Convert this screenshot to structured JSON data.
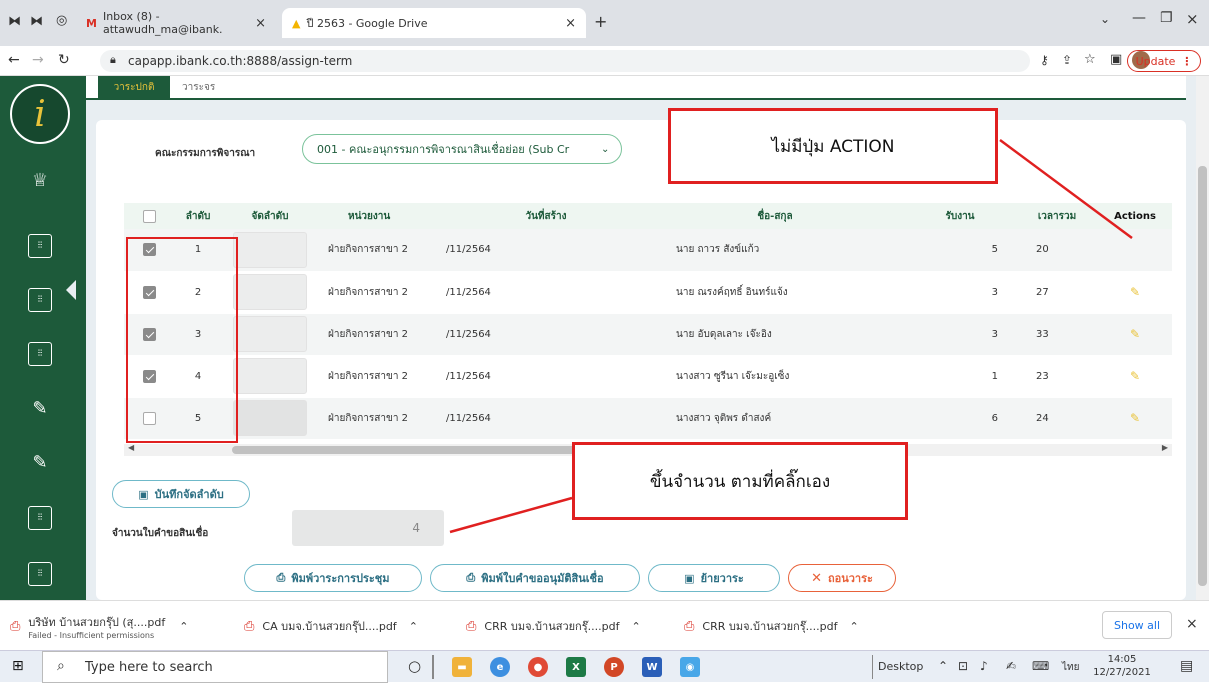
{
  "browser": {
    "tabs": [
      {
        "label": "Inbox (8) - attawudh_ma@ibank."
      },
      {
        "label": "ปี 2563 - Google Drive"
      }
    ],
    "new_tab": "+",
    "url": "capapp.ibank.co.th:8888/assign-term",
    "update_label": "Update"
  },
  "page": {
    "top_tabs": [
      "วาระปกติ",
      "วาระจร"
    ],
    "committee_label": "คณะกรรมการพิจารณา",
    "committee_value": "001 - คณะอนุกรรมการพิจารณาสินเชื่อย่อย (Sub Cr",
    "table": {
      "headers": [
        "ลำดับ",
        "จัดลำดับ",
        "หน่วยงาน",
        "วันที่สร้าง",
        "ชื่อ-สกุล",
        "รับงาน",
        "เวลารวม",
        "Actions"
      ],
      "rows": [
        {
          "no": "1",
          "unit": "ฝ่ายกิจการสาขา 2",
          "date": "/11/2564",
          "name": "นาย ถาวร สังข์แก้ว",
          "received": "5",
          "total": "20",
          "checked": true,
          "has_action": false
        },
        {
          "no": "2",
          "unit": "ฝ่ายกิจการสาขา 2",
          "date": "/11/2564",
          "name": "นาย ณรงค์ฤทธิ์ อินทร์แจ้ง",
          "received": "3",
          "total": "27",
          "checked": true,
          "has_action": true
        },
        {
          "no": "3",
          "unit": "ฝ่ายกิจการสาขา 2",
          "date": "/11/2564",
          "name": "นาย อับดุลเลาะ เจ๊ะอิง",
          "received": "3",
          "total": "33",
          "checked": true,
          "has_action": true
        },
        {
          "no": "4",
          "unit": "ฝ่ายกิจการสาขา 2",
          "date": "/11/2564",
          "name": "นางสาว ซูรีนา เจ๊ะมะอูเซ็ง",
          "received": "1",
          "total": "23",
          "checked": true,
          "has_action": true
        },
        {
          "no": "5",
          "unit": "ฝ่ายกิจการสาขา 2",
          "date": "/11/2564",
          "name": "นางสาว จุติพร ดำสงค์",
          "received": "6",
          "total": "24",
          "checked": false,
          "has_action": true
        }
      ]
    },
    "save_order_label": "บันทึกจัดลำดับ",
    "count_label": "จำนวนใบคำขอสินเชื่อ",
    "count_value": "4",
    "buttons": {
      "print_agenda": "พิมพ์วาระการประชุม",
      "print_request": "พิมพ์ใบคำขออนุมัติสินเชื่อ",
      "move_agenda": "ย้ายวาระ",
      "withdraw_agenda": "ถอนวาระ"
    },
    "annotations": {
      "no_action": "ไม่มีปุ่ม ACTION",
      "count_note": "ขึ้นจำนวน ตามที่คลิ๊กเอง"
    }
  },
  "downloads": {
    "items": [
      {
        "name": "บริษัท บ้านสวยกรุ๊ป (สุ....pdf",
        "status": "Failed - Insufficient permissions"
      },
      {
        "name": "CA บมจ.บ้านสวยกรุ๊ป....pdf",
        "status": ""
      },
      {
        "name": "CRR บมจ.บ้านสวยกรุ๊....pdf",
        "status": ""
      },
      {
        "name": "CRR บมจ.บ้านสวยกรุ๊....pdf",
        "status": ""
      }
    ],
    "show_all": "Show all"
  },
  "taskbar": {
    "search_placeholder": "Type here to search",
    "desktop_label": "Desktop",
    "lang": "ไทย",
    "time": "14:05",
    "date": "12/27/2021"
  },
  "colors": {
    "sidebar": "#1d5a3a",
    "accent_gold": "#e9c33a",
    "annotation_red": "#e02020"
  }
}
